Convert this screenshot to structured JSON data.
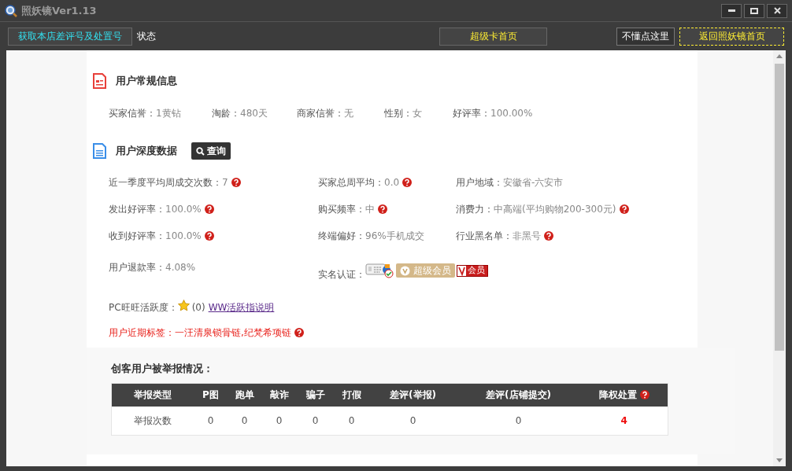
{
  "window": {
    "title": "照妖镜Ver1.13"
  },
  "toolbar": {
    "fetch_button": "获取本店差评号及处置号",
    "status_label": "状态",
    "center_button": "超级卡首页",
    "help_button": "不懂点这里",
    "home_button": "返回照妖镜首页"
  },
  "basic_info": {
    "title": "用户常规信息",
    "fields": [
      {
        "label": "买家信誉：",
        "value": "1黄钻"
      },
      {
        "label": "淘龄：",
        "value": "480天"
      },
      {
        "label": "商家信誉：",
        "value": "无"
      },
      {
        "label": "性别：",
        "value": "女"
      },
      {
        "label": "好评率：",
        "value": "100.00%"
      }
    ]
  },
  "deep_data": {
    "title": "用户深度数据",
    "query_button": "查询",
    "fields": [
      {
        "kind": "text",
        "label": "近一季度平均周成交次数：",
        "value": "7",
        "help": true
      },
      {
        "kind": "text",
        "label": "买家总周平均：",
        "value": "0.0",
        "help": true
      },
      {
        "kind": "text",
        "label": "用户地域：",
        "value": "安徽省-六安市",
        "help": false
      },
      {
        "kind": "text",
        "label": "发出好评率：",
        "value": "100.0%",
        "help": true
      },
      {
        "kind": "text",
        "label": "购买频率：",
        "value": "中",
        "help": true
      },
      {
        "kind": "text",
        "label": "消费力：",
        "value": "中高端(平均购物200-300元)",
        "help": true
      },
      {
        "kind": "text",
        "label": "收到好评率：",
        "value": "100.0%",
        "help": true
      },
      {
        "kind": "text",
        "label": "终端偏好：",
        "value": "96%手机成交",
        "help": false
      },
      {
        "kind": "text",
        "label": "行业黑名单：",
        "value": "非黑号",
        "help": true
      },
      {
        "kind": "text",
        "label": "用户退款率：",
        "value": "4.08%",
        "help": false
      },
      {
        "kind": "badges",
        "label": "实名认证：",
        "badges": [
          "超级会员",
          "会员"
        ]
      }
    ],
    "activity": {
      "label": "PC旺旺活跃度：",
      "count": "(0)",
      "link": "WW活跃指说明"
    },
    "tags": {
      "text": "用户近期标签：一汪清泉锁骨链,纪梵希项链",
      "help": true
    }
  },
  "report": {
    "title": "创客用户被举报情况：",
    "columns": [
      {
        "label": "举报类型",
        "help": false
      },
      {
        "label": "P图",
        "help": false
      },
      {
        "label": "跑单",
        "help": false
      },
      {
        "label": "敲诈",
        "help": false
      },
      {
        "label": "骗子",
        "help": false
      },
      {
        "label": "打假",
        "help": false
      },
      {
        "label": "差评(举报)",
        "help": false
      },
      {
        "label": "差评(店铺提交)",
        "help": false
      },
      {
        "label": "降权处置",
        "help": true
      }
    ],
    "rows": [
      [
        {
          "text": "举报次数",
          "alert": false
        },
        {
          "text": "0",
          "alert": false
        },
        {
          "text": "0",
          "alert": false
        },
        {
          "text": "0",
          "alert": false
        },
        {
          "text": "0",
          "alert": false
        },
        {
          "text": "0",
          "alert": false
        },
        {
          "text": "0",
          "alert": false
        },
        {
          "text": "0",
          "alert": false
        },
        {
          "text": "4",
          "alert": true
        }
      ]
    ]
  }
}
